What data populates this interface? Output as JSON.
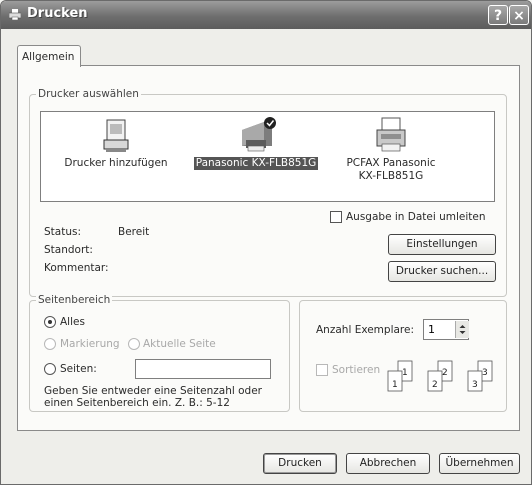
{
  "window": {
    "title": "Drucken",
    "help_label": "?",
    "close_label": "×"
  },
  "tabs": [
    {
      "label": "Allgemein"
    }
  ],
  "select_printer": {
    "group_label": "Drucker auswählen",
    "printers": [
      {
        "label": "Drucker hinzufügen",
        "icon": "add-printer-icon"
      },
      {
        "label": "Panasonic KX-FLB851G",
        "icon": "printer-icon",
        "selected": true
      },
      {
        "label": "PCFAX Panasonic\nKX-FLB851G",
        "icon": "fax-printer-icon"
      }
    ],
    "status_label": "Status:",
    "status_value": "Bereit",
    "location_label": "Standort:",
    "location_value": "",
    "comment_label": "Kommentar:",
    "comment_value": "",
    "print_to_file_label": "Ausgabe in Datei umleiten",
    "settings_button": "Einstellungen",
    "find_printer_button": "Drucker suchen..."
  },
  "page_range": {
    "group_label": "Seitenbereich",
    "all_label": "Alles",
    "selection_label": "Markierung",
    "current_page_label": "Aktuelle Seite",
    "pages_label": "Seiten:",
    "pages_value": "",
    "hint_line1": "Geben Sie entweder eine Seitenzahl oder",
    "hint_line2": "einen Seitenbereich ein. Z. B.: 5-12"
  },
  "copies": {
    "label": "Anzahl Exemplare:",
    "value": "1",
    "collate_label": "Sortieren",
    "page_numbers": [
      "1",
      "1",
      "2",
      "2",
      "3",
      "3"
    ]
  },
  "footer": {
    "print_button": "Drucken",
    "cancel_button": "Abbrechen",
    "apply_button": "Übernehmen"
  }
}
